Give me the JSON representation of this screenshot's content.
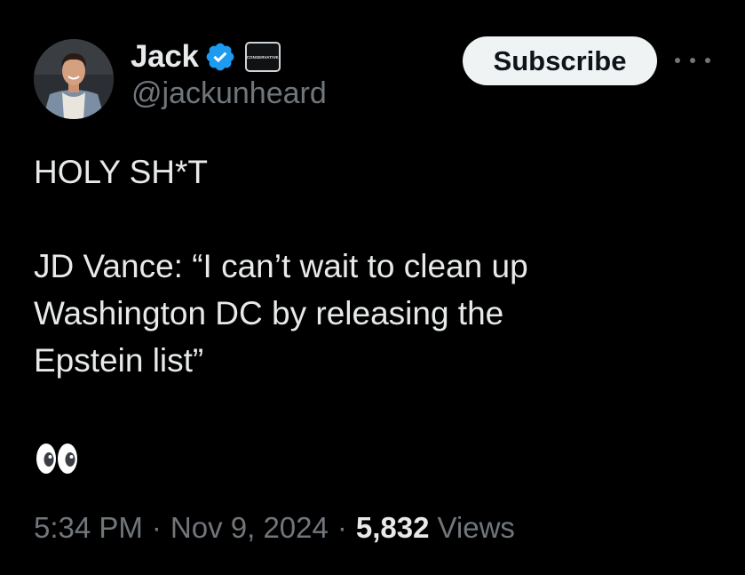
{
  "colors": {
    "background": "#000000",
    "primary_text": "#e7e9ea",
    "secondary_text": "#71767b",
    "verified_blue": "#1d9bf0",
    "subscribe_bg": "#eff3f4"
  },
  "author": {
    "display_name": "Jack",
    "handle": "@jackunheard",
    "verified_icon": "verified-badge-icon",
    "affiliation_badge_text": "CONSERVATIVE"
  },
  "actions": {
    "subscribe_label": "Subscribe",
    "more_icon": "more-options-icon"
  },
  "tweet": {
    "line_1": "HOLY SH*T",
    "line_2": "JD Vance: “I can’t wait to clean up\nWashington DC by releasing the\nEpstein list”",
    "emoji": "eyes-emoji-icon"
  },
  "meta": {
    "time": "5:34 PM",
    "separator": "·",
    "date": "Nov 9, 2024",
    "views_count": "5,832",
    "views_label": "Views"
  }
}
